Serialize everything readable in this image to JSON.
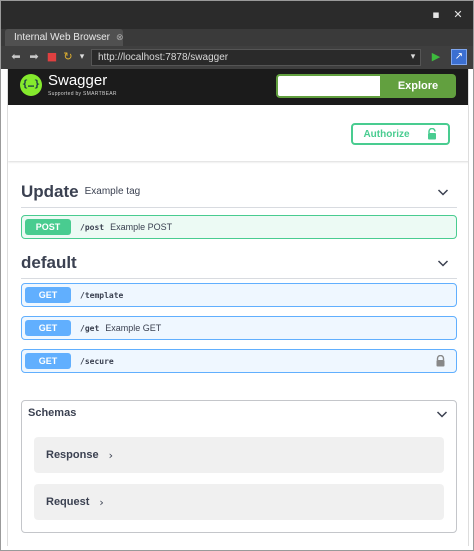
{
  "window": {
    "maximize_icon": "▪",
    "close_icon": "✕"
  },
  "tab": {
    "title": "Internal Web Browser",
    "close": "⊗"
  },
  "toolbar": {
    "back": "⬅",
    "forward": "➡",
    "stop": "■",
    "refresh": "↻",
    "menu": "▾",
    "url": "http://localhost:7878/swagger",
    "dropdown": "▾",
    "go": "▶",
    "external": "↗"
  },
  "swagger": {
    "logo_glyph": "{…}",
    "name": "Swagger",
    "subtitle": "Supported by SMARTBEAR",
    "explore_placeholder": "",
    "explore_label": "Explore",
    "authorize_label": "Authorize"
  },
  "tags": [
    {
      "name": "Update",
      "description": "Example tag",
      "operations": [
        {
          "method": "POST",
          "path": "/post",
          "summary": "Example POST"
        }
      ]
    },
    {
      "name": "default",
      "description": "",
      "operations": [
        {
          "method": "GET",
          "path": "/template",
          "summary": ""
        },
        {
          "method": "GET",
          "path": "/get",
          "summary": "Example GET"
        },
        {
          "method": "GET",
          "path": "/secure",
          "summary": ""
        }
      ]
    }
  ],
  "schemas": {
    "title": "Schemas",
    "items": [
      {
        "name": "Response",
        "arrow": "›"
      },
      {
        "name": "Request",
        "arrow": "›"
      }
    ]
  },
  "colors": {
    "post": "#49cc90",
    "get": "#61affe",
    "explore": "#62a03f",
    "topbar": "#1b1b1b"
  }
}
